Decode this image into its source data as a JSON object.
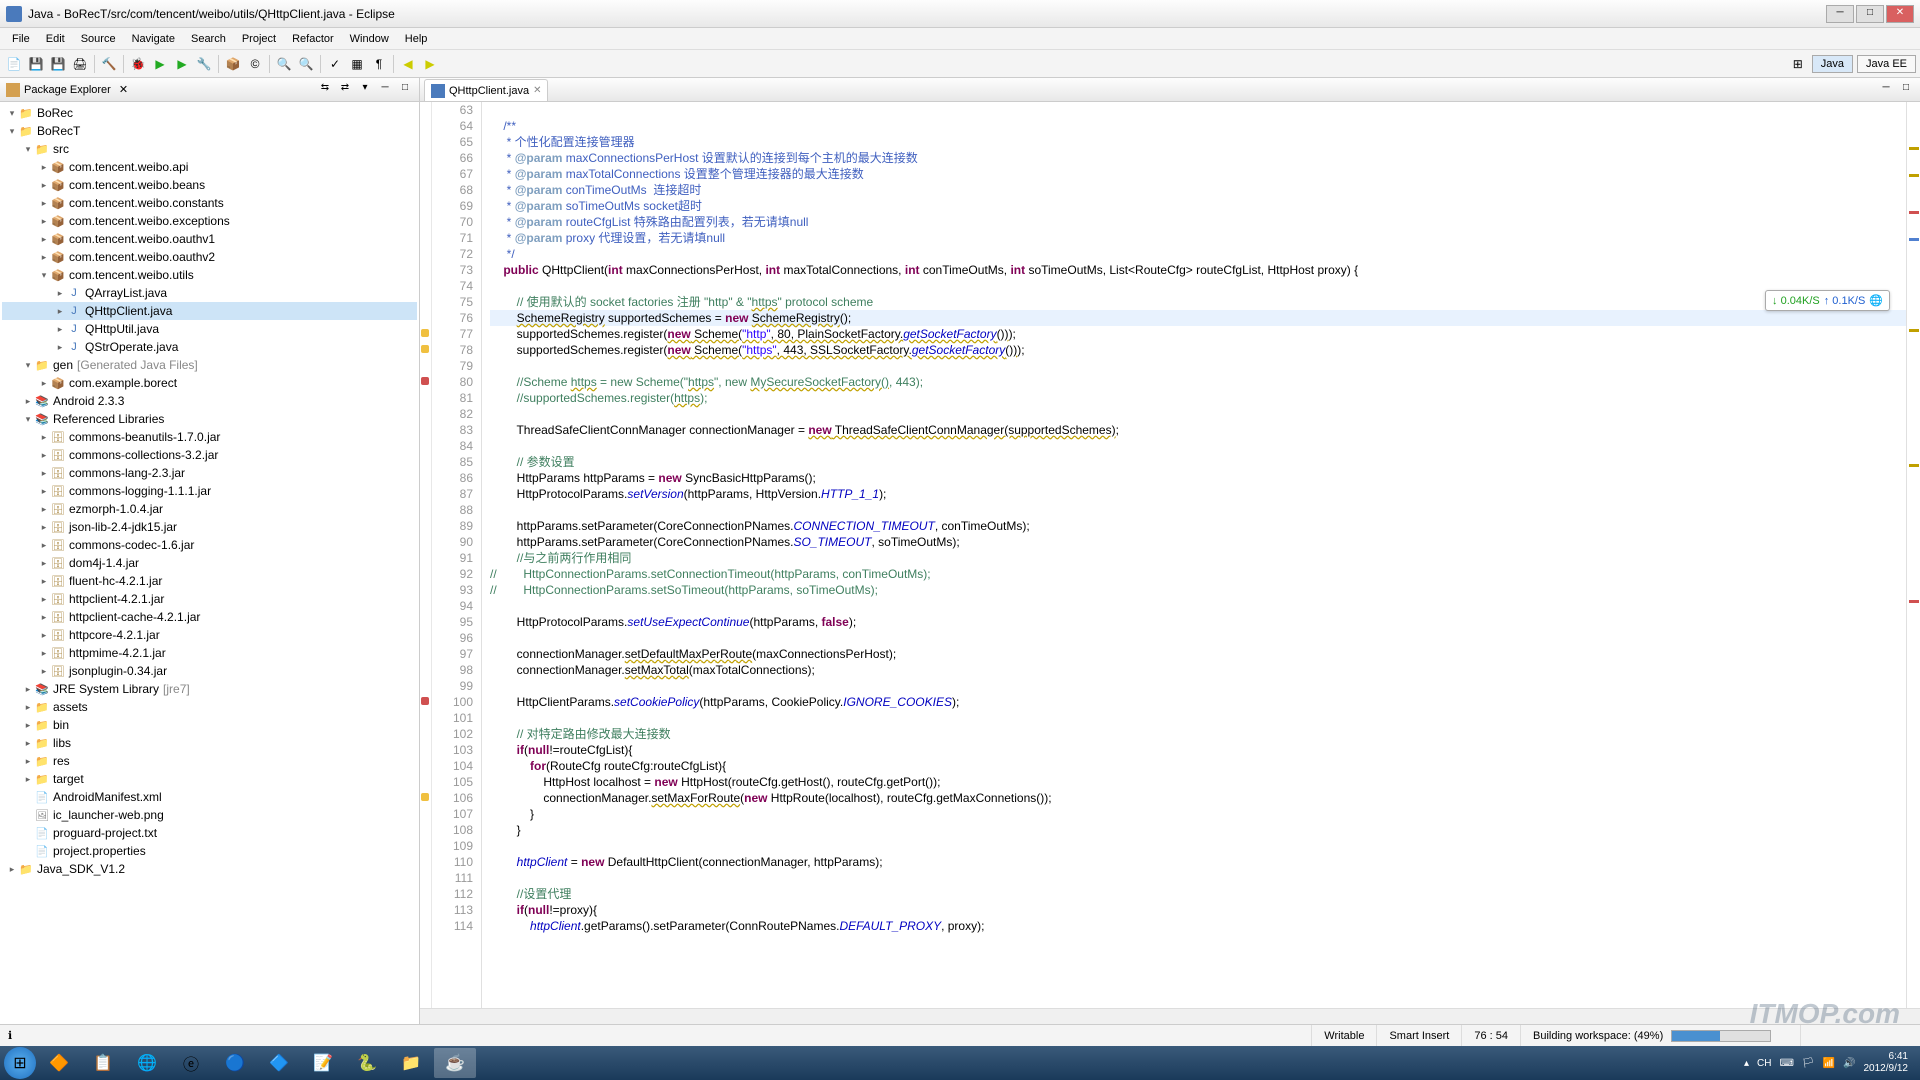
{
  "title": "Java - BoRecT/src/com/tencent/weibo/utils/QHttpClient.java - Eclipse",
  "menu": [
    "File",
    "Edit",
    "Source",
    "Navigate",
    "Search",
    "Project",
    "Refactor",
    "Window",
    "Help"
  ],
  "perspectives": {
    "java": "Java",
    "javaee": "Java EE"
  },
  "sidebar": {
    "title": "Package Explorer"
  },
  "tree": [
    {
      "d": 0,
      "e": "▾",
      "i": "📁",
      "c": "icon-project",
      "t": "BoRec"
    },
    {
      "d": 0,
      "e": "▾",
      "i": "📁",
      "c": "icon-project",
      "t": "BoRecT"
    },
    {
      "d": 1,
      "e": "▾",
      "i": "📁",
      "c": "icon-folder",
      "t": "src"
    },
    {
      "d": 2,
      "e": "▸",
      "i": "📦",
      "c": "icon-package",
      "t": "com.tencent.weibo.api"
    },
    {
      "d": 2,
      "e": "▸",
      "i": "📦",
      "c": "icon-package",
      "t": "com.tencent.weibo.beans"
    },
    {
      "d": 2,
      "e": "▸",
      "i": "📦",
      "c": "icon-package",
      "t": "com.tencent.weibo.constants"
    },
    {
      "d": 2,
      "e": "▸",
      "i": "📦",
      "c": "icon-package",
      "t": "com.tencent.weibo.exceptions"
    },
    {
      "d": 2,
      "e": "▸",
      "i": "📦",
      "c": "icon-package",
      "t": "com.tencent.weibo.oauthv1"
    },
    {
      "d": 2,
      "e": "▸",
      "i": "📦",
      "c": "icon-package",
      "t": "com.tencent.weibo.oauthv2"
    },
    {
      "d": 2,
      "e": "▾",
      "i": "📦",
      "c": "icon-package",
      "t": "com.tencent.weibo.utils"
    },
    {
      "d": 3,
      "e": "▸",
      "i": "J",
      "c": "icon-java",
      "t": "QArrayList.java"
    },
    {
      "d": 3,
      "e": "▸",
      "i": "J",
      "c": "icon-java",
      "t": "QHttpClient.java",
      "sel": true
    },
    {
      "d": 3,
      "e": "▸",
      "i": "J",
      "c": "icon-java",
      "t": "QHttpUtil.java"
    },
    {
      "d": 3,
      "e": "▸",
      "i": "J",
      "c": "icon-java",
      "t": "QStrOperate.java"
    },
    {
      "d": 1,
      "e": "▾",
      "i": "📁",
      "c": "icon-folder",
      "t": "gen",
      "suf": "[Generated Java Files]"
    },
    {
      "d": 2,
      "e": "▸",
      "i": "📦",
      "c": "icon-package",
      "t": "com.example.borect"
    },
    {
      "d": 1,
      "e": "▸",
      "i": "📚",
      "c": "icon-lib",
      "t": "Android 2.3.3"
    },
    {
      "d": 1,
      "e": "▾",
      "i": "📚",
      "c": "icon-lib",
      "t": "Referenced Libraries"
    },
    {
      "d": 2,
      "e": "▸",
      "i": "🗄",
      "c": "icon-jar",
      "t": "commons-beanutils-1.7.0.jar"
    },
    {
      "d": 2,
      "e": "▸",
      "i": "🗄",
      "c": "icon-jar",
      "t": "commons-collections-3.2.jar"
    },
    {
      "d": 2,
      "e": "▸",
      "i": "🗄",
      "c": "icon-jar",
      "t": "commons-lang-2.3.jar"
    },
    {
      "d": 2,
      "e": "▸",
      "i": "🗄",
      "c": "icon-jar",
      "t": "commons-logging-1.1.1.jar"
    },
    {
      "d": 2,
      "e": "▸",
      "i": "🗄",
      "c": "icon-jar",
      "t": "ezmorph-1.0.4.jar"
    },
    {
      "d": 2,
      "e": "▸",
      "i": "🗄",
      "c": "icon-jar",
      "t": "json-lib-2.4-jdk15.jar"
    },
    {
      "d": 2,
      "e": "▸",
      "i": "🗄",
      "c": "icon-jar",
      "t": "commons-codec-1.6.jar"
    },
    {
      "d": 2,
      "e": "▸",
      "i": "🗄",
      "c": "icon-jar",
      "t": "dom4j-1.4.jar"
    },
    {
      "d": 2,
      "e": "▸",
      "i": "🗄",
      "c": "icon-jar",
      "t": "fluent-hc-4.2.1.jar"
    },
    {
      "d": 2,
      "e": "▸",
      "i": "🗄",
      "c": "icon-jar",
      "t": "httpclient-4.2.1.jar"
    },
    {
      "d": 2,
      "e": "▸",
      "i": "🗄",
      "c": "icon-jar",
      "t": "httpclient-cache-4.2.1.jar"
    },
    {
      "d": 2,
      "e": "▸",
      "i": "🗄",
      "c": "icon-jar",
      "t": "httpcore-4.2.1.jar"
    },
    {
      "d": 2,
      "e": "▸",
      "i": "🗄",
      "c": "icon-jar",
      "t": "httpmime-4.2.1.jar"
    },
    {
      "d": 2,
      "e": "▸",
      "i": "🗄",
      "c": "icon-jar",
      "t": "jsonplugin-0.34.jar"
    },
    {
      "d": 1,
      "e": "▸",
      "i": "📚",
      "c": "icon-lib",
      "t": "JRE System Library",
      "suf": "[jre7]"
    },
    {
      "d": 1,
      "e": "▸",
      "i": "📁",
      "c": "icon-folder",
      "t": "assets"
    },
    {
      "d": 1,
      "e": "▸",
      "i": "📁",
      "c": "icon-folder",
      "t": "bin"
    },
    {
      "d": 1,
      "e": "▸",
      "i": "📁",
      "c": "icon-folder",
      "t": "libs"
    },
    {
      "d": 1,
      "e": "▸",
      "i": "📁",
      "c": "icon-folder",
      "t": "res"
    },
    {
      "d": 1,
      "e": "▸",
      "i": "📁",
      "c": "icon-folder",
      "t": "target"
    },
    {
      "d": 1,
      "e": "",
      "i": "📄",
      "c": "icon-file",
      "t": "AndroidManifest.xml"
    },
    {
      "d": 1,
      "e": "",
      "i": "🖼",
      "c": "icon-file",
      "t": "ic_launcher-web.png"
    },
    {
      "d": 1,
      "e": "",
      "i": "📄",
      "c": "icon-file",
      "t": "proguard-project.txt"
    },
    {
      "d": 1,
      "e": "",
      "i": "📄",
      "c": "icon-file",
      "t": "project.properties"
    },
    {
      "d": 0,
      "e": "▸",
      "i": "📁",
      "c": "icon-project",
      "t": "Java_SDK_V1.2"
    }
  ],
  "editor": {
    "tab": "QHttpClient.java"
  },
  "code": {
    "start": 63,
    "highlightLine": 76,
    "markers": {
      "77": "warn",
      "78": "warn",
      "80": "err",
      "100": "err",
      "106": "warn"
    },
    "lines": [
      "",
      "    <span class=\"jd\">/**</span>",
      "    <span class=\"jd\"> * 个性化配置连接管理器</span>",
      "    <span class=\"jd\"> * <span class=\"jdt\">@param</span> maxConnectionsPerHost 设置默认的连接到每个主机的最大连接数</span>",
      "    <span class=\"jd\"> * <span class=\"jdt\">@param</span> maxTotalConnections 设置整个管理连接器的最大连接数</span>",
      "    <span class=\"jd\"> * <span class=\"jdt\">@param</span> conTimeOutMs  连接超时</span>",
      "    <span class=\"jd\"> * <span class=\"jdt\">@param</span> soTimeOutMs socket超时</span>",
      "    <span class=\"jd\"> * <span class=\"jdt\">@param</span> routeCfgList 特殊路由配置列表，若无请填null</span>",
      "    <span class=\"jd\"> * <span class=\"jdt\">@param</span> proxy 代理设置，若无请填null</span>",
      "    <span class=\"jd\"> */</span>",
      "    <span class=\"kw\">public</span> QHttpClient(<span class=\"kw\">int</span> maxConnectionsPerHost, <span class=\"kw\">int</span> maxTotalConnections, <span class=\"kw\">int</span> conTimeOutMs, <span class=\"kw\">int</span> soTimeOutMs, List&lt;RouteCfg&gt; routeCfgList, HttpHost proxy) {",
      "",
      "        <span class=\"cm\">// 使用默认的 socket factories 注册 \"http\" &amp; \"<span class=\"warn-u\">https</span>\" protocol scheme</span>",
      "        <span class=\"warn-u\">SchemeRegistry</span> supportedSchemes = <span class=\"kw\">new</span> <span class=\"warn-u\">SchemeRegistry</span>();",
      "        supportedSchemes.register(<span class=\"warn-u\"><span class=\"kw\">new</span> Scheme(<span class=\"str\">\"http\"</span>, 80, PlainSocketFactory.<span class=\"stc\">getSocketFactory</span>())</span>);",
      "        supportedSchemes.register(<span class=\"warn-u\"><span class=\"kw\">new</span> Scheme(<span class=\"str\">\"https\"</span>, 443, SSLSocketFactory.<span class=\"stc\">getSocketFactory</span>())</span>);",
      "",
      "        <span class=\"cm\">//Scheme <span class=\"warn-u\">https</span> = new Scheme(\"<span class=\"warn-u\">https</span>\", new <span class=\"warn-u\">MySecureSocketFactory()</span>, 443);</span>",
      "        <span class=\"cm\">//supportedSchemes.register(<span class=\"warn-u\">https</span>);</span>",
      "",
      "        ThreadSafeClientConnManager connectionManager = <span class=\"warn-u\"><span class=\"kw\">new</span> ThreadSafeClientConnManager(supportedSchemes)</span>;",
      "",
      "        <span class=\"cm\">// 参数设置</span>",
      "        HttpParams httpParams = <span class=\"kw\">new</span> SyncBasicHttpParams();",
      "        HttpProtocolParams.<span class=\"stc\">setVersion</span>(httpParams, HttpVersion.<span class=\"stc\">HTTP_1_1</span>);",
      "",
      "        httpParams.setParameter(CoreConnectionPNames.<span class=\"stc\">CONNECTION_TIMEOUT</span>, conTimeOutMs);",
      "        httpParams.setParameter(CoreConnectionPNames.<span class=\"stc\">SO_TIMEOUT</span>, soTimeOutMs);",
      "        <span class=\"cm\">//与之前两行作用相同</span>",
      "<span class=\"cm\">//        HttpConnectionParams.setConnectionTimeout(httpParams, conTimeOutMs);</span>",
      "<span class=\"cm\">//        HttpConnectionParams.setSoTimeout(httpParams, soTimeOutMs);</span>",
      "",
      "        HttpProtocolParams.<span class=\"stc\">setUseExpectContinue</span>(httpParams, <span class=\"kw\">false</span>);",
      "",
      "        connectionManager.<span class=\"warn-u\">setDefaultMaxPerRoute</span>(maxConnectionsPerHost);",
      "        connectionManager.<span class=\"warn-u\">setMaxTotal</span>(maxTotalConnections);",
      "",
      "        HttpClientParams.<span class=\"stc\">setCookiePolicy</span>(httpParams, CookiePolicy.<span class=\"stc\">IGNORE_COOKIES</span>);",
      "",
      "        <span class=\"cm\">// 对特定路由修改最大连接数</span>",
      "        <span class=\"kw\">if</span>(<span class=\"kw\">null</span>!=routeCfgList){",
      "            <span class=\"kw\">for</span>(RouteCfg routeCfg:routeCfgList){",
      "                HttpHost localhost = <span class=\"kw\">new</span> HttpHost(routeCfg.getHost(), routeCfg.getPort());",
      "                connectionManager.<span class=\"warn-u\">setMaxForRoute</span>(<span class=\"kw\">new</span> HttpRoute(localhost), routeCfg.getMaxConnetions());",
      "            }",
      "        }",
      "",
      "        <span class=\"fld\">httpClient</span> = <span class=\"kw\">new</span> DefaultHttpClient(connectionManager, httpParams);",
      "",
      "        <span class=\"cm\">//设置代理</span>",
      "        <span class=\"kw\">if</span>(<span class=\"kw\">null</span>!=proxy){",
      "            <span class=\"fld\">httpClient</span>.getParams().setParameter(ConnRoutePNames.<span class=\"stc\">DEFAULT_PROXY</span>, proxy);"
    ]
  },
  "status": {
    "writable": "Writable",
    "insert": "Smart Insert",
    "pos": "76 : 54",
    "building": "Building workspace: (49%)"
  },
  "net": {
    "down": "↓ 0.04K/S",
    "up": "↑ 0.1K/S"
  },
  "clock": {
    "time": "6:41",
    "date": "2012/9/12"
  },
  "watermark": "ITMOP.com"
}
